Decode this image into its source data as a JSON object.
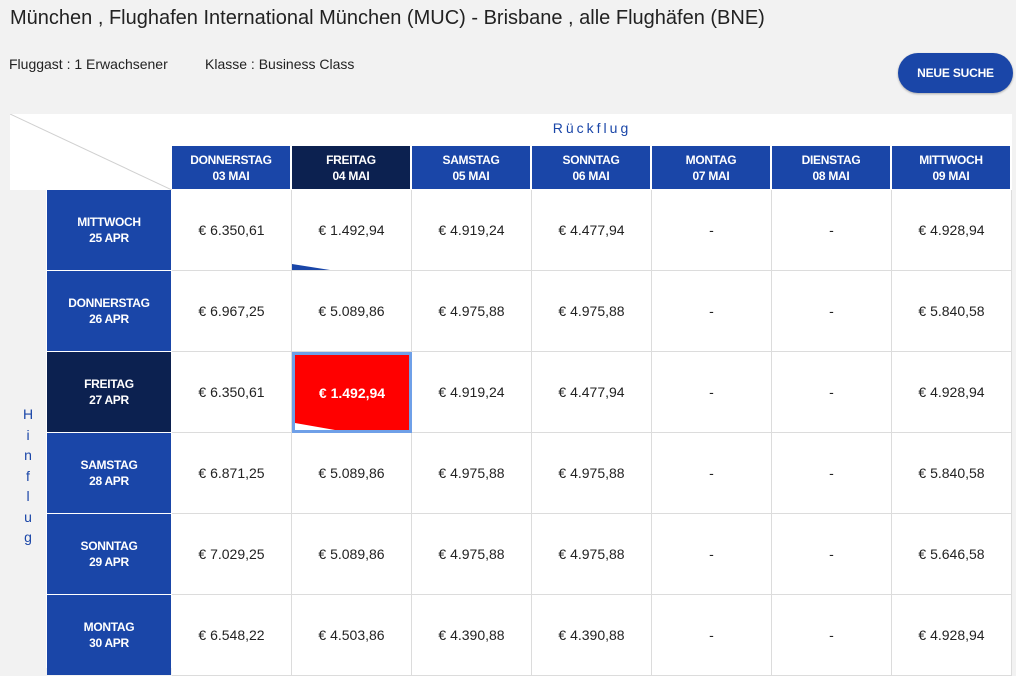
{
  "header": {
    "title": "München , Flughafen International München (MUC) - Brisbane , alle Flughäfen (BNE)",
    "passengers": "Fluggast : 1 Erwachsener",
    "class": "Klasse : Business Class",
    "new_search_label": "NEUE SUCHE"
  },
  "matrix": {
    "return_label": "Rückflug",
    "outbound_label": [
      "H",
      "i",
      "n",
      "f",
      "l",
      "u",
      "g"
    ],
    "columns": [
      {
        "day": "DONNERSTAG",
        "date": "03 MAI"
      },
      {
        "day": "FREITAG",
        "date": "04 MAI"
      },
      {
        "day": "SAMSTAG",
        "date": "05 MAI"
      },
      {
        "day": "SONNTAG",
        "date": "06 MAI"
      },
      {
        "day": "MONTAG",
        "date": "07 MAI"
      },
      {
        "day": "DIENSTAG",
        "date": "08 MAI"
      },
      {
        "day": "MITTWOCH",
        "date": "09 MAI"
      }
    ],
    "rows": [
      {
        "day": "MITTWOCH",
        "date": "25 APR",
        "prices": [
          "€ 6.350,61",
          "€ 1.492,94",
          "€ 4.919,24",
          "€ 4.477,94",
          "-",
          "-",
          "€ 4.928,94"
        ]
      },
      {
        "day": "DONNERSTAG",
        "date": "26 APR",
        "prices": [
          "€ 6.967,25",
          "€ 5.089,86",
          "€ 4.975,88",
          "€ 4.975,88",
          "-",
          "-",
          "€ 5.840,58"
        ]
      },
      {
        "day": "FREITAG",
        "date": "27 APR",
        "prices": [
          "€ 6.350,61",
          "€ 1.492,94",
          "€ 4.919,24",
          "€ 4.477,94",
          "-",
          "-",
          "€ 4.928,94"
        ]
      },
      {
        "day": "SAMSTAG",
        "date": "28 APR",
        "prices": [
          "€ 6.871,25",
          "€ 5.089,86",
          "€ 4.975,88",
          "€ 4.975,88",
          "-",
          "-",
          "€ 5.840,58"
        ]
      },
      {
        "day": "SONNTAG",
        "date": "29 APR",
        "prices": [
          "€ 7.029,25",
          "€ 5.089,86",
          "€ 4.975,88",
          "€ 4.975,88",
          "-",
          "-",
          "€ 5.646,58"
        ]
      },
      {
        "day": "MONTAG",
        "date": "30 APR",
        "prices": [
          "€ 6.548,22",
          "€ 4.503,86",
          "€ 4.390,88",
          "€ 4.390,88",
          "-",
          "-",
          "€ 4.928,94"
        ]
      }
    ],
    "selected_row": 2,
    "selected_col": 1
  },
  "colors": {
    "header_blue": "#1a46a8",
    "selected_navy": "#0c2150",
    "highlight_red": "#ff0000",
    "highlight_border": "#6fa0e8"
  }
}
